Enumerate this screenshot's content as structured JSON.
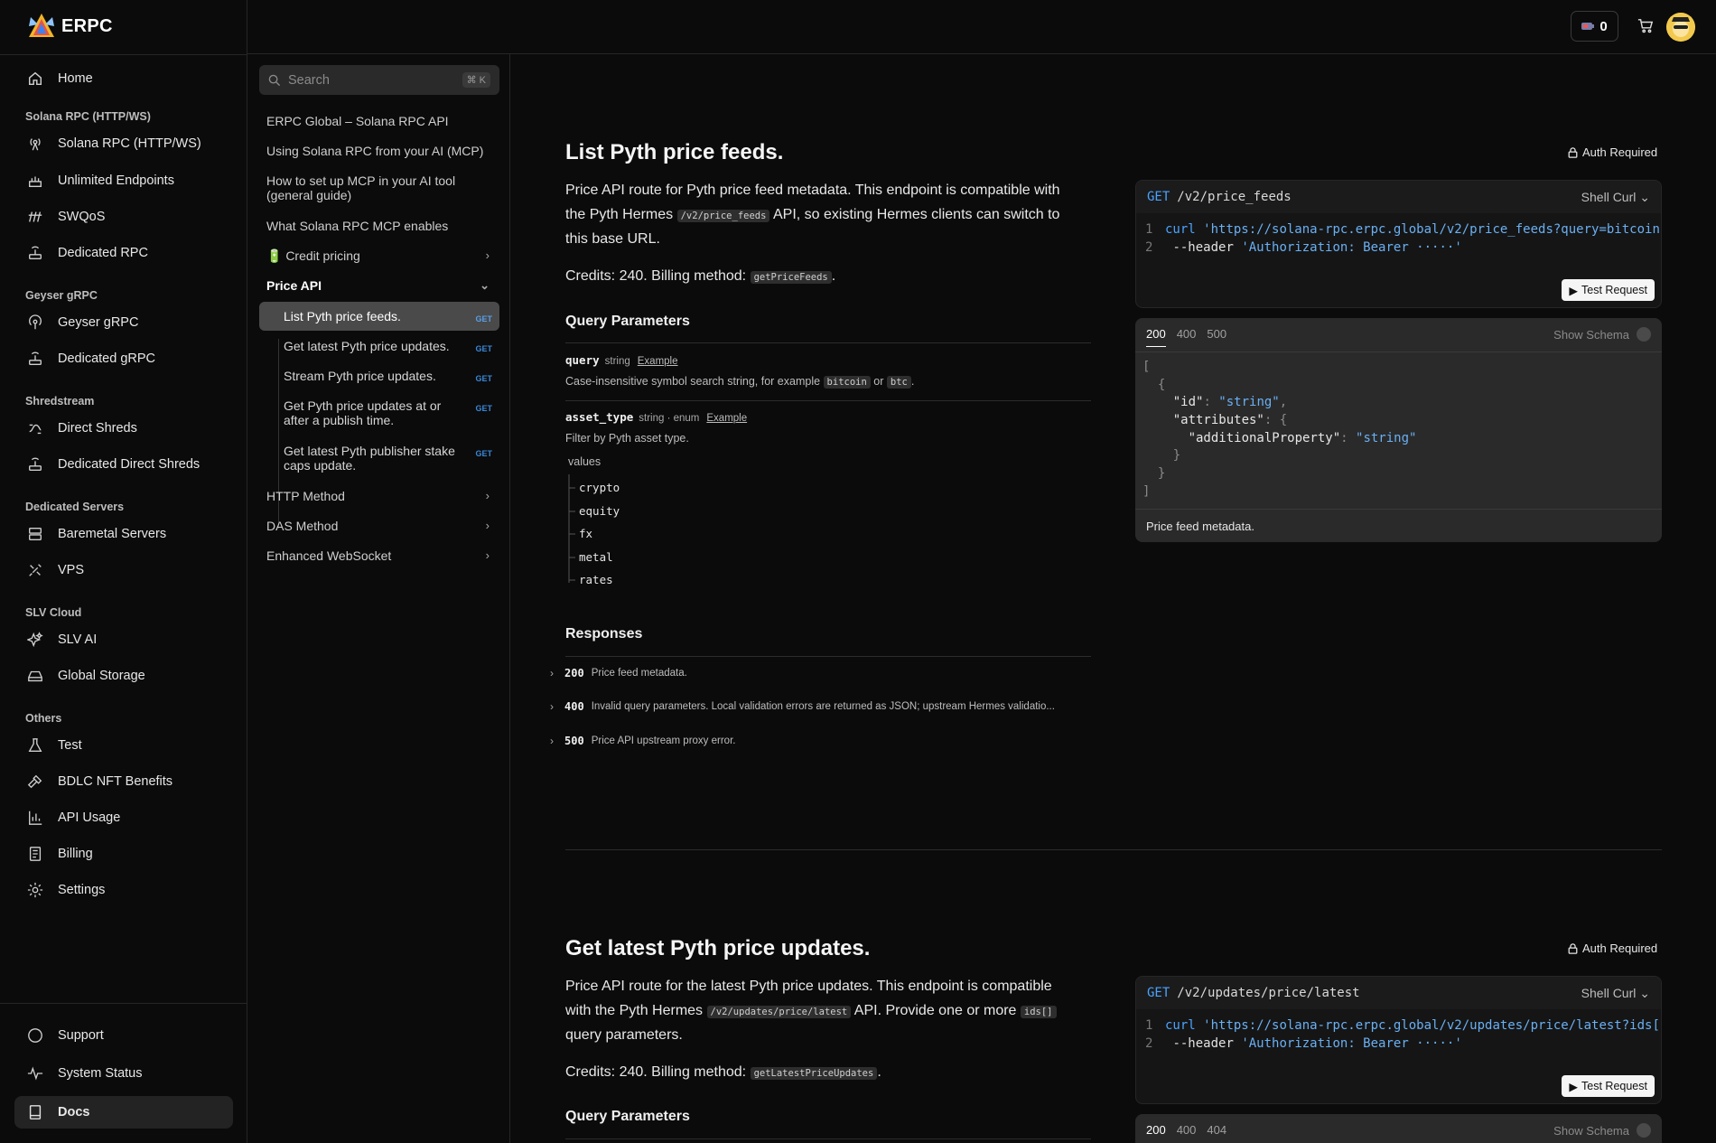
{
  "app": {
    "logo_text": "ERPC"
  },
  "topbar": {
    "credits": "0"
  },
  "sidebar": {
    "home": "Home",
    "groups": [
      {
        "title": "Solana RPC (HTTP/WS)",
        "items": [
          "Solana RPC (HTTP/WS)",
          "Unlimited Endpoints",
          "SWQoS",
          "Dedicated RPC"
        ]
      },
      {
        "title": "Geyser gRPC",
        "items": [
          "Geyser gRPC",
          "Dedicated gRPC"
        ]
      },
      {
        "title": "Shredstream",
        "items": [
          "Direct Shreds",
          "Dedicated Direct Shreds"
        ]
      },
      {
        "title": "Dedicated Servers",
        "items": [
          "Baremetal Servers",
          "VPS"
        ]
      },
      {
        "title": "SLV Cloud",
        "items": [
          "SLV AI",
          "Global Storage"
        ]
      },
      {
        "title": "Others",
        "items": [
          "Test",
          "BDLC NFT Benefits",
          "API Usage",
          "Billing",
          "Settings"
        ]
      }
    ],
    "footer": [
      "Support",
      "System Status",
      "Docs"
    ]
  },
  "docnav": {
    "search_placeholder": "Search",
    "search_kbd": "⌘ K",
    "items": [
      "ERPC Global – Solana RPC API",
      "Using Solana RPC from your AI (MCP)",
      "How to set up MCP in your AI tool (general guide)",
      "What Solana RPC MCP enables",
      "🔋 Credit pricing",
      "Price API"
    ],
    "price_api_children": [
      {
        "label": "List Pyth price feeds.",
        "method": "GET"
      },
      {
        "label": "Get latest Pyth price updates.",
        "method": "GET"
      },
      {
        "label": "Stream Pyth price updates.",
        "method": "GET"
      },
      {
        "label": "Get Pyth price updates at or after a publish time.",
        "method": "GET"
      },
      {
        "label": "Get latest Pyth publisher stake caps update.",
        "method": "GET"
      }
    ],
    "bottom_items": [
      "HTTP Method",
      "DAS Method",
      "Enhanced WebSocket"
    ]
  },
  "section1": {
    "title": "List Pyth price feeds.",
    "auth": "Auth Required",
    "desc_a": "Price API route for Pyth price feed metadata. This endpoint is compatible with",
    "desc_b1": "the Pyth Hermes",
    "desc_code": "/v2/price_feeds",
    "desc_b2": "API, so existing Hermes clients can switch to",
    "desc_c": "this base URL.",
    "credits_text": "Credits: 240. Billing method:",
    "billing_method": "getPriceFeeds",
    "query_title": "Query Parameters",
    "params": [
      {
        "name": "query",
        "type": "string",
        "example": "Example",
        "desc_a": "Case-insensitive symbol search string, for example",
        "code1": "bitcoin",
        "or": "or",
        "code2": "btc"
      },
      {
        "name": "asset_type",
        "type": "string · enum",
        "example": "Example",
        "desc": "Filter by Pyth asset type.",
        "values_label": "values",
        "values": [
          "crypto",
          "equity",
          "fx",
          "metal",
          "rates"
        ]
      }
    ],
    "responses_title": "Responses",
    "responses": [
      {
        "code": "200",
        "text": "Price feed metadata."
      },
      {
        "code": "400",
        "text": "Invalid query parameters. Local validation errors are returned as JSON; upstream Hermes validatio..."
      },
      {
        "code": "500",
        "text": "Price API upstream proxy error."
      }
    ],
    "request": {
      "method": "GET",
      "path": "/v2/price_feeds",
      "lang": "Shell Curl",
      "line1_cmd": "curl",
      "line1_url": "'https://solana-rpc.erpc.global/v2/price_feeds?query=bitcoin",
      "line2_flag": "--header",
      "line2_val": "'Authorization: Bearer ·····'",
      "test_label": "Test Request"
    },
    "response_panel": {
      "tabs": [
        "200",
        "400",
        "500"
      ],
      "show_schema": "Show Schema",
      "caption": "Price feed metadata."
    }
  },
  "section2": {
    "title": "Get latest Pyth price updates.",
    "auth": "Auth Required",
    "desc_a": "Price API route for the latest Pyth price updates. This endpoint is compatible",
    "desc_b1": "with the Pyth Hermes",
    "desc_code": "/v2/updates/price/latest",
    "desc_b2": "API. Provide one or more",
    "desc_code2": "ids[]",
    "desc_c": "query parameters.",
    "credits_text": "Credits: 240. Billing method:",
    "billing_method": "getLatestPriceUpdates",
    "query_title": "Query Parameters",
    "request": {
      "method": "GET",
      "path": "/v2/updates/price/latest",
      "lang": "Shell Curl",
      "line1_cmd": "curl",
      "line1_url": "'https://solana-rpc.erpc.global/v2/updates/price/latest?ids[",
      "line2_flag": "--header",
      "line2_val": "'Authorization: Bearer ·····'",
      "test_label": "Test Request"
    },
    "response_panel": {
      "tabs": [
        "200",
        "400",
        "404"
      ],
      "show_schema": "Show Schema"
    }
  }
}
